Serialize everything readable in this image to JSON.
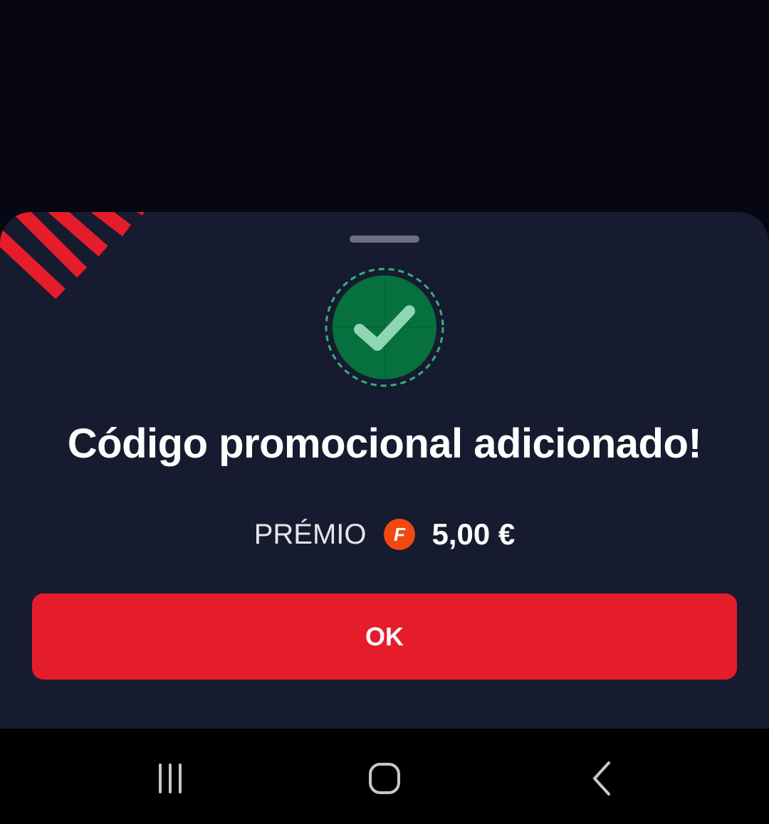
{
  "dialog": {
    "title": "Código promocional adicionado!",
    "prize_label": "PRÉMIO",
    "coin_letter": "F",
    "prize_value": "5,00 €",
    "ok_label": "OK"
  },
  "icons": {
    "success": "checkmark-circle-icon",
    "coin": "coin-f-icon",
    "nav_recents": "recent-apps-icon",
    "nav_home": "home-icon",
    "nav_back": "back-icon"
  },
  "colors": {
    "backdrop": "#070714",
    "sheet": "#171b2f",
    "accent_red": "#e51d2b",
    "success_green": "#07703f",
    "check": "#8fd6b3",
    "coin_orange": "#f04a10"
  }
}
